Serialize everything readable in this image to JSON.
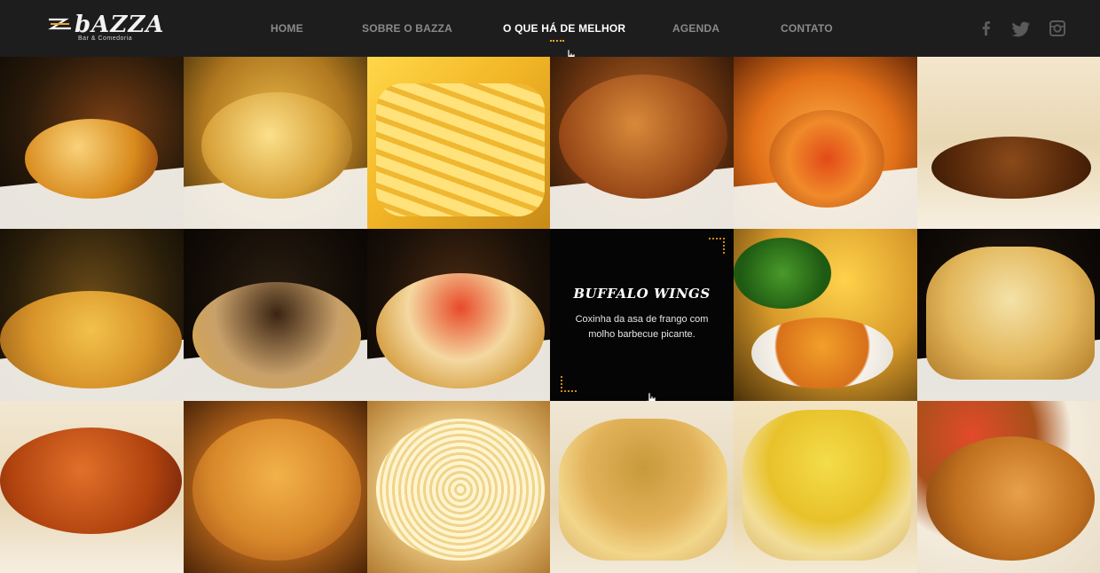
{
  "brand": {
    "name": "bAZZA",
    "tagline": "Bar & Comedoria"
  },
  "nav": {
    "home": "HOME",
    "sobre": "SOBRE O BAZZA",
    "melhor": "O QUE HÁ DE MELHOR",
    "agenda": "AGENDA",
    "contato": "CONTATO"
  },
  "social": [
    "facebook-icon",
    "twitter-icon",
    "instagram-icon"
  ],
  "featured": {
    "title": "BUFFALO WINGS",
    "description": "Coxinha da asa de frango com molho barbecue picante."
  },
  "colors": {
    "accent": "#e8a628",
    "header_bg": "#1d1d1d",
    "nav_text": "#8a8a8a"
  },
  "tiles": [
    {
      "name": "dish-croquettes-bacon"
    },
    {
      "name": "dish-roasted-potatoes"
    },
    {
      "name": "dish-french-fries"
    },
    {
      "name": "dish-breaded-cutlets"
    },
    {
      "name": "dish-stuffed-balls"
    },
    {
      "name": "dish-kebab-skewers"
    },
    {
      "name": "dish-shrimp-toast"
    },
    {
      "name": "dish-mushroom-toast"
    },
    {
      "name": "dish-tomato-bruschetta"
    },
    {
      "name": "featured-buffalo-wings"
    },
    {
      "name": "dish-salad-soup"
    },
    {
      "name": "dish-savory-pastry"
    },
    {
      "name": "dish-fried-shrimp"
    },
    {
      "name": "dish-breaded-shrimp"
    },
    {
      "name": "dish-pasta-salad"
    },
    {
      "name": "dish-tartlet-vegetable"
    },
    {
      "name": "dish-tartlet-rice"
    },
    {
      "name": "dish-chicken-skewers"
    }
  ]
}
